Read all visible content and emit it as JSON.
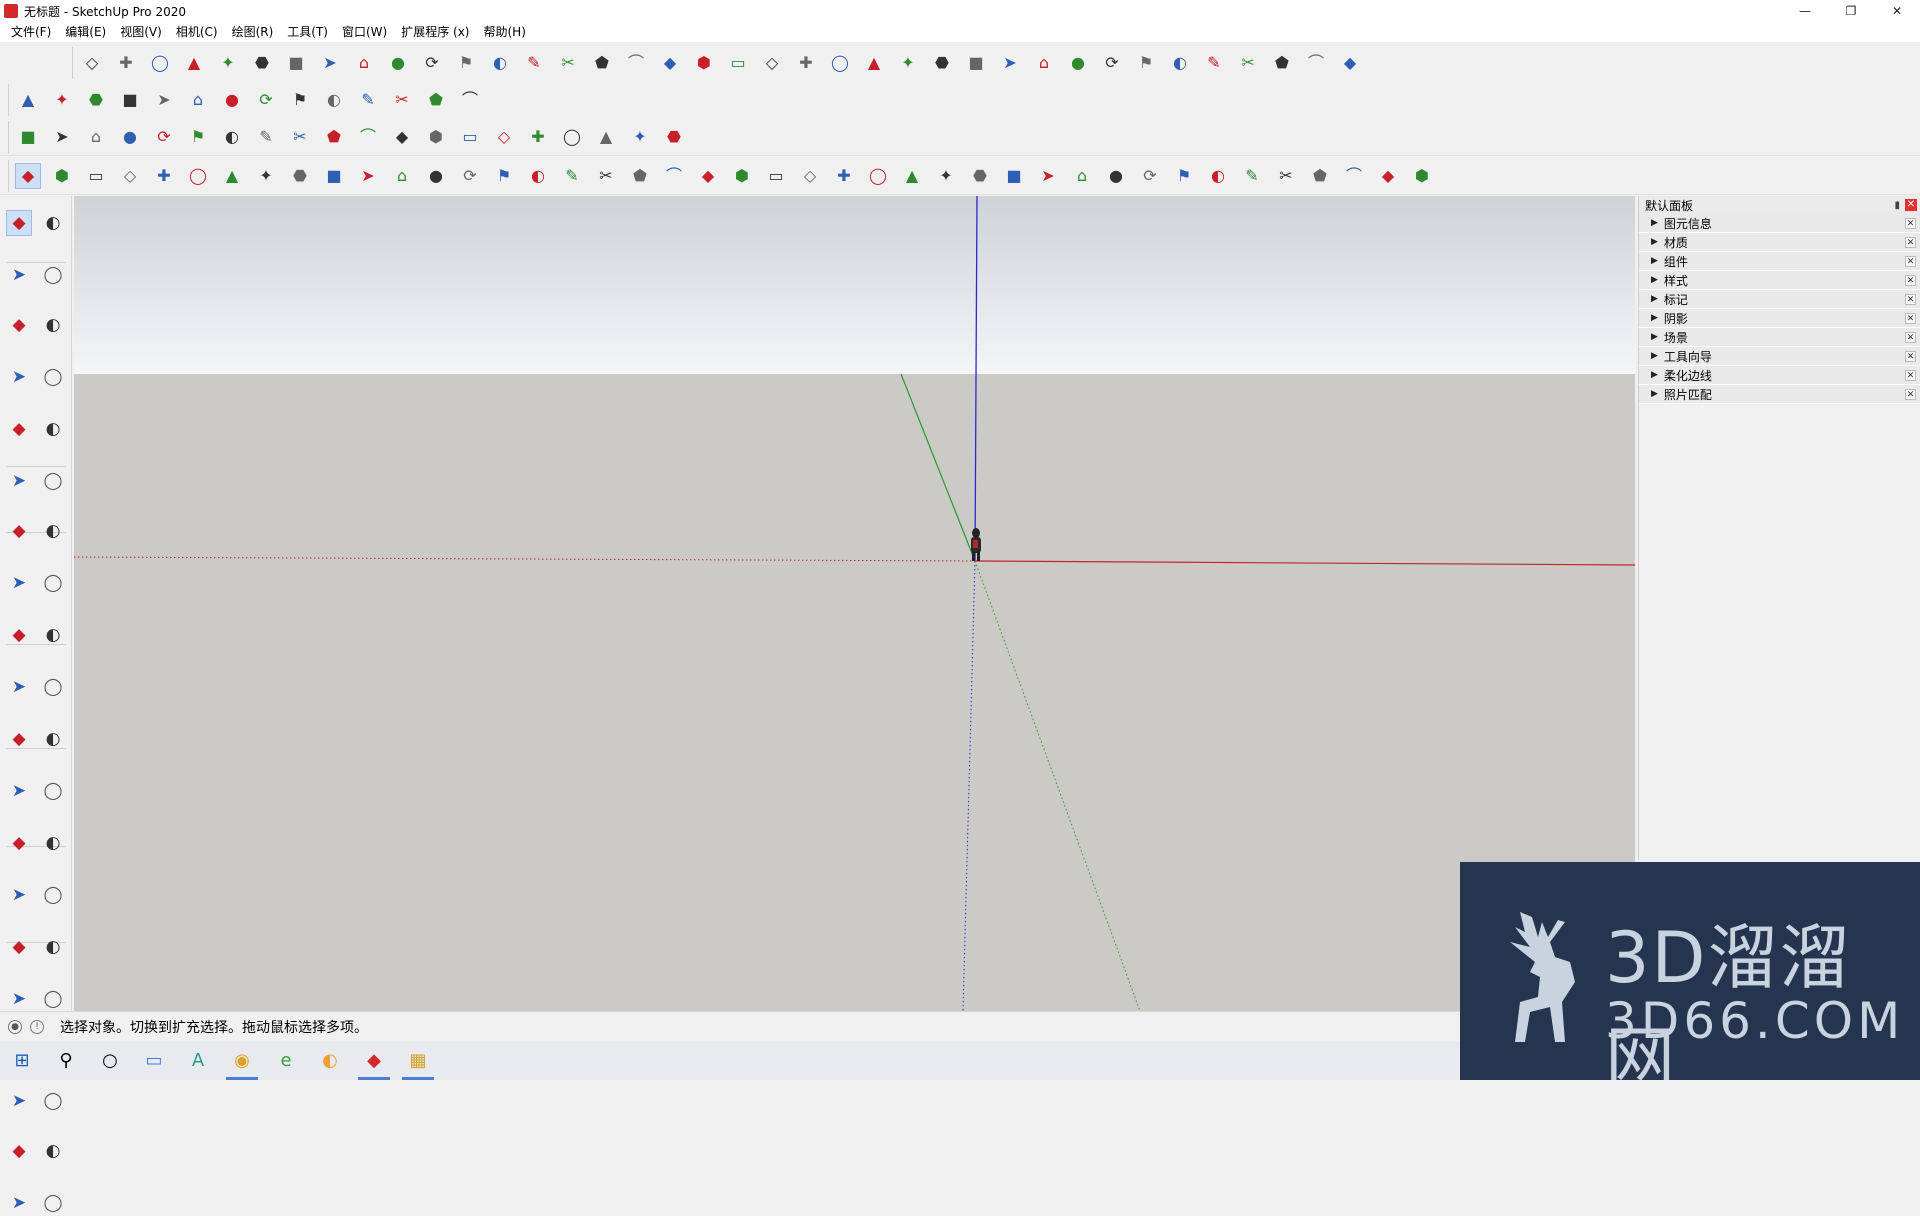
{
  "window": {
    "title": "无标题 - SketchUp Pro 2020",
    "controls": [
      "—",
      "❐",
      "✕"
    ]
  },
  "menu": [
    "文件(F)",
    "编辑(E)",
    "视图(V)",
    "相机(C)",
    "绘图(R)",
    "工具(T)",
    "窗口(W)",
    "扩展程序 (x)",
    "帮助(H)"
  ],
  "tray": {
    "title": "默认面板",
    "items": [
      "图元信息",
      "材质",
      "组件",
      "样式",
      "标记",
      "阴影",
      "场景",
      "工具向导",
      "柔化边线",
      "照片匹配"
    ]
  },
  "status": {
    "text": "选择对象。切换到扩充选择。拖动鼠标选择多项。"
  },
  "watermark": {
    "title": "3D溜溜网",
    "subtitle": "3D66.COM"
  },
  "colors": {
    "axis_red": "#c0272d",
    "axis_green": "#2b9a2b",
    "axis_blue": "#2a2ad0",
    "sky": "#eef0f3",
    "ground": "#cbcac6",
    "watermark_bg": "#26354f"
  },
  "toolbars": {
    "row1_icons": [
      "follow-me-icon",
      "offset-icon",
      "intersect-icon",
      "outer-shell-icon",
      "split-icon",
      "trim-icon",
      "union-icon",
      "subtract-icon",
      "box-icon",
      "sphere-icon",
      "cylinder-icon",
      "cone-icon",
      "torus-icon",
      "pyramid-icon",
      "tube-icon",
      "fillet-icon",
      "chamfer-icon",
      "extrude-icon",
      "sweep-icon",
      "loft-icon",
      "lathe-icon",
      "stairs-icon",
      "rails-icon",
      "wall-icon",
      "roof-icon",
      "window-icon",
      "door-icon",
      "fence-icon",
      "beam-icon",
      "column-icon",
      "hatch-icon",
      "array-icon",
      "mirror-icon",
      "align-icon",
      "scale-icon",
      "weld-icon",
      "flatten-icon",
      "unfold-icon"
    ],
    "row2_icons": [
      "bezier-icon",
      "spline-icon",
      "polyline-icon",
      "catenary-icon",
      "arc-icon",
      "rectangle-icon",
      "circle-icon",
      "ellipse-icon",
      "curve-icon",
      "fillet-curve-icon",
      "smooth-icon",
      "loop-icon",
      "join-icon",
      "tree-icon"
    ],
    "row3_icons": [
      "orbit-icon",
      "zoom-icon",
      "zoom-window-icon",
      "zoom-extents-icon",
      "previous-icon",
      "pan-icon",
      "walk-icon",
      "look-around-icon",
      "position-camera-icon",
      "section-plane-icon",
      "component-icon",
      "group-icon",
      "materials-icon",
      "styles-icon",
      "layers-icon",
      "scenes-icon",
      "shadows-icon",
      "fog-icon",
      "soften-icon",
      "photo-match-icon"
    ],
    "row4_icons": [
      "select-icon",
      "eraser-icon",
      "pencil-icon",
      "arc-tool-icon",
      "shape-icon",
      "push-pull-icon",
      "follow-me-tool-icon",
      "move-icon",
      "rotate-icon",
      "scale-tool-icon",
      "tape-icon",
      "text-icon",
      "paint-icon",
      "orbit-tool-icon",
      "pan-tool-icon",
      "zoom-tool-icon",
      "zoom-ext-icon",
      "warehouse-icon",
      "extension-icon",
      "ruby-icon",
      "user-icon",
      "iso-icon",
      "top-icon",
      "front-icon",
      "right-icon",
      "back-icon",
      "left-icon",
      "house-icon",
      "house2-icon",
      "house3-icon",
      "xray-icon",
      "wireframe-icon",
      "hidden-line-icon",
      "shaded-icon",
      "textured-icon",
      "monochrome-icon",
      "section-cut-icon",
      "section-fill-icon",
      "sandbox-icon",
      "smoove-icon",
      "drape-icon",
      "flip-edge-icon"
    ]
  }
}
